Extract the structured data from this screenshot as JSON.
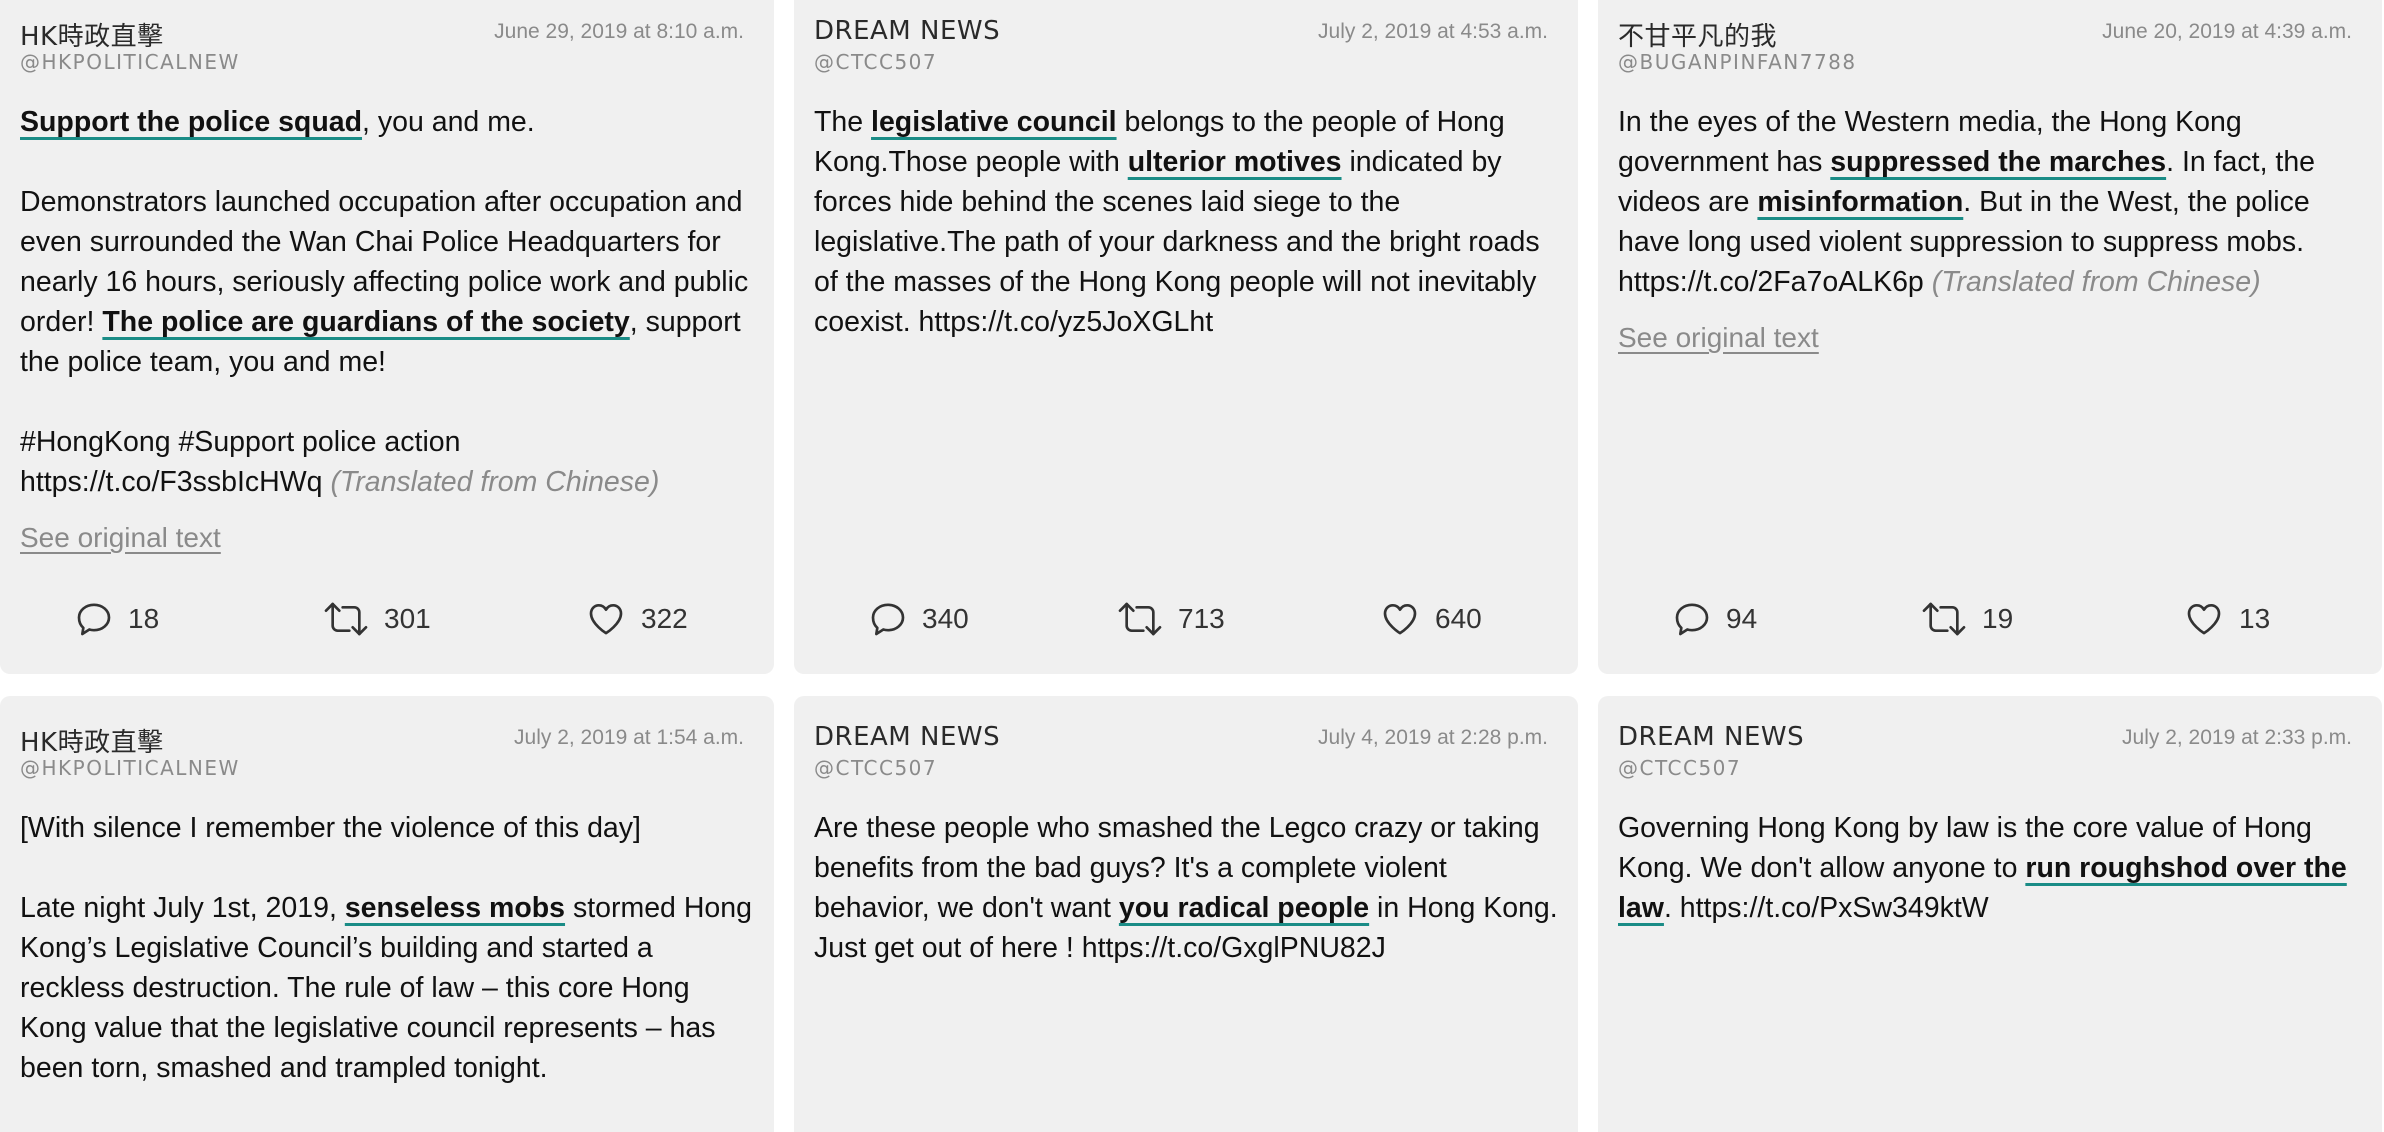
{
  "tweets": [
    {
      "author": "HK時政直擊",
      "handle": "@HKPOLITICALNEW",
      "date": "June 29, 2019 at 8:10 a.m.",
      "p1": [
        {
          "t": "Support the police squad",
          "hl": true
        },
        {
          "t": ", you and me."
        }
      ],
      "p2": [
        {
          "t": "Demonstrators launched occupation after occupation and even surrounded the Wan Chai Police Headquarters for nearly 16 hours, seriously affecting police work and public order! "
        },
        {
          "t": "The police are guardians of the society",
          "hl": true
        },
        {
          "t": ", support the police team, you and me!"
        }
      ],
      "p3": [
        {
          "t": "#HongKong #Support police action https://t.co/F3ssbIcHWq "
        },
        {
          "t": "(Translated from Chinese)",
          "tr": true
        }
      ],
      "see_original": "See original text",
      "stats": {
        "replies": "18",
        "retweets": "301",
        "likes": "322"
      }
    },
    {
      "author": "DREAM NEWS",
      "handle": "@CTCC507",
      "date": "July 2, 2019 at 4:53 a.m.",
      "p1": [
        {
          "t": "The "
        },
        {
          "t": "legislative council",
          "hl": true
        },
        {
          "t": " belongs to the people of Hong Kong.Those people with "
        },
        {
          "t": "ulterior motives",
          "hl": true
        },
        {
          "t": " indicated by forces hide behind the scenes laid siege to the legislative.The path of your darkness and the bright roads of the masses of the Hong Kong people will not inevitably coexist. https://t.co/yz5JoXGLht"
        }
      ],
      "stats": {
        "replies": "340",
        "retweets": "713",
        "likes": "640"
      }
    },
    {
      "author": "不甘平凡的我",
      "handle": "@BUGANPINFAN7788",
      "date": "June 20, 2019 at 4:39 a.m.",
      "p1": [
        {
          "t": "In the eyes of the Western media, the Hong Kong government has "
        },
        {
          "t": "suppressed the marches",
          "hl": true
        },
        {
          "t": ". In fact, the videos are "
        },
        {
          "t": "misinformation",
          "hl": true
        },
        {
          "t": ". But in the West, the police have long used violent suppression to suppress mobs. https://t.co/2Fa7oALK6p "
        },
        {
          "t": "(Translated from Chinese)",
          "tr": true
        }
      ],
      "see_original": "See original text",
      "stats": {
        "replies": "94",
        "retweets": "19",
        "likes": "13"
      }
    },
    {
      "author": "HK時政直擊",
      "handle": "@HKPOLITICALNEW",
      "date": "July 2, 2019 at 1:54 a.m.",
      "p1": [
        {
          "t": "[With silence I remember the violence of this day]"
        }
      ],
      "p2": [
        {
          "t": "Late night July 1st, 2019, "
        },
        {
          "t": "senseless mobs",
          "hl": true
        },
        {
          "t": " stormed Hong Kong’s Legislative Council’s building and started a reckless destruction. The rule of law – this core Hong Kong value that the legislative council represents – has been torn, smashed and trampled tonight."
        }
      ]
    },
    {
      "author": "DREAM NEWS",
      "handle": "@CTCC507",
      "date": "July 4, 2019 at 2:28 p.m.",
      "p1": [
        {
          "t": "Are these people who smashed the Legco crazy or taking benefits from the bad guys? It's a complete violent behavior, we don't want "
        },
        {
          "t": "you radical people",
          "hl": true
        },
        {
          "t": " in Hong Kong. Just get out of here ! https://t.co/GxglPNU82J"
        }
      ]
    },
    {
      "author": "DREAM NEWS",
      "handle": "@CTCC507",
      "date": "July 2, 2019 at 2:33 p.m.",
      "p1": [
        {
          "t": "Governing Hong Kong by law is the core value of Hong Kong. We don't allow anyone to "
        },
        {
          "t": "run roughshod over the law",
          "hl": true
        },
        {
          "t": ". https://t.co/PxSw349ktW"
        }
      ]
    }
  ],
  "icons": {
    "reply": "speech-bubble-icon",
    "retweet": "retweet-arrows-icon",
    "like": "heart-icon"
  },
  "colors": {
    "card_bg": "#f0f0f0",
    "highlight_underline": "#1a8c86",
    "muted_text": "#8a8a8a"
  }
}
